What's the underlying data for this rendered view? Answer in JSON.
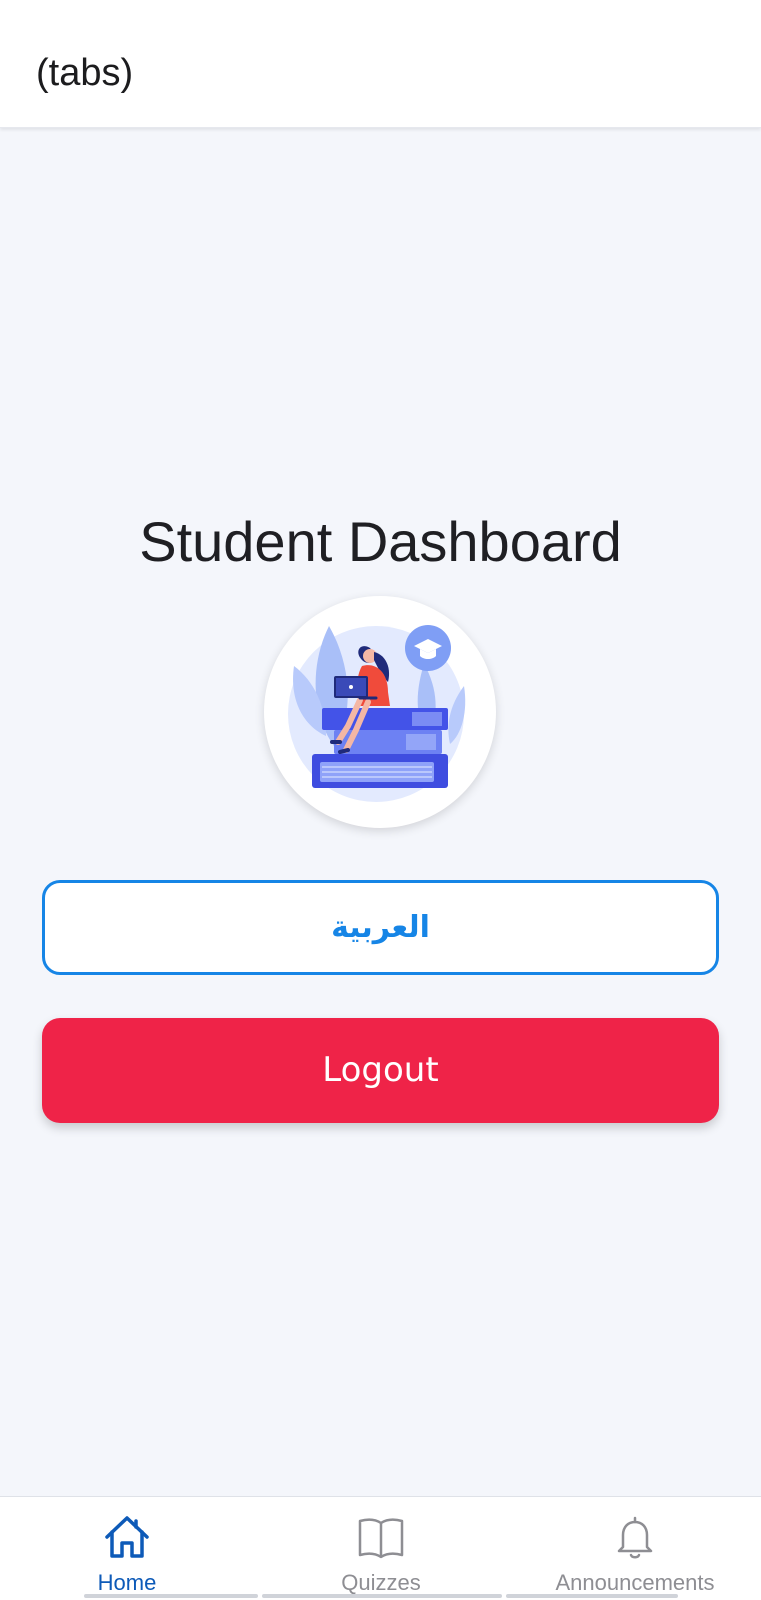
{
  "header": {
    "title": "(tabs)"
  },
  "main": {
    "title": "Student Dashboard",
    "language_button": "العربية",
    "logout_button": "Logout"
  },
  "tabs": [
    {
      "label": "Home",
      "icon": "home-icon",
      "active": true
    },
    {
      "label": "Quizzes",
      "icon": "book-icon",
      "active": false
    },
    {
      "label": "Announcements",
      "icon": "bell-icon",
      "active": false
    }
  ],
  "colors": {
    "accent": "#1685e6",
    "active_tab": "#0d5ab8",
    "logout": "#ef2348",
    "background": "#f4f6fb"
  }
}
